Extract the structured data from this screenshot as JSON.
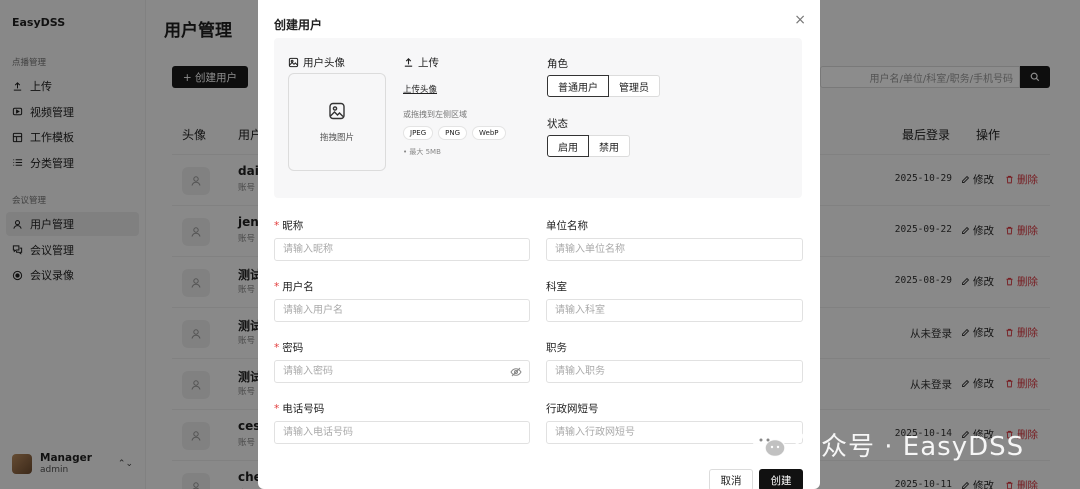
{
  "sidebar": {
    "brand": "EasyDSS",
    "groups": [
      {
        "title": "点播管理",
        "items": [
          {
            "label": "上传",
            "icon": "upload-icon"
          },
          {
            "label": "视频管理",
            "icon": "video-icon"
          },
          {
            "label": "工作模板",
            "icon": "template-icon"
          },
          {
            "label": "分类管理",
            "icon": "list-icon"
          }
        ]
      },
      {
        "title": "会议管理",
        "items": [
          {
            "label": "用户管理",
            "icon": "user-icon",
            "active": true
          },
          {
            "label": "会议管理",
            "icon": "meeting-icon"
          },
          {
            "label": "会议录像",
            "icon": "record-icon"
          }
        ]
      }
    ],
    "user": {
      "name": "Manager",
      "account": "admin"
    }
  },
  "page": {
    "title": "用户管理",
    "create_label": "+ 创建用户",
    "search_placeholder": "用户名/单位/科室/职务/手机号码",
    "columns": {
      "avatar": "头像",
      "user": "用户",
      "last_login": "最后登录",
      "ops": "操作"
    },
    "rows": [
      {
        "name": "dai",
        "account": "账号",
        "last_login": "2025-10-29"
      },
      {
        "name": "jen",
        "account": "账号",
        "last_login": "2025-09-22"
      },
      {
        "name": "测试",
        "account": "账号",
        "last_login": "2025-08-29"
      },
      {
        "name": "测试",
        "account": "账号",
        "last_login": "从未登录"
      },
      {
        "name": "测试",
        "account": "账号",
        "last_login": "从未登录"
      },
      {
        "name": "ces",
        "account": "账号",
        "last_login": "2025-10-14"
      },
      {
        "name": "che",
        "account": "账号",
        "last_login": "2025-10-11"
      }
    ],
    "edit_label": "修改",
    "delete_label": "删除"
  },
  "modal": {
    "title": "创建用户",
    "close": "×",
    "avatar_label": "用户头像",
    "drop_text": "拖拽图片",
    "upload_label": "上传",
    "upload_link": "上传头像",
    "upload_hint": "或拖拽到左侧区域",
    "formats": [
      "JPEG",
      "PNG",
      "WebP"
    ],
    "max_size": "• 最大 5MB",
    "role_label": "角色",
    "roles": [
      "普通用户",
      "管理员"
    ],
    "status_label": "状态",
    "statuses": [
      "启用",
      "禁用"
    ],
    "fields": {
      "nickname": {
        "label": "昵称",
        "placeholder": "请输入昵称",
        "required": true
      },
      "username": {
        "label": "用户名",
        "placeholder": "请输入用户名",
        "required": true
      },
      "password": {
        "label": "密码",
        "placeholder": "请输入密码",
        "required": true
      },
      "phone": {
        "label": "电话号码",
        "placeholder": "请输入电话号码",
        "required": true
      },
      "org": {
        "label": "单位名称",
        "placeholder": "请输入单位名称"
      },
      "dept": {
        "label": "科室",
        "placeholder": "请输入科室"
      },
      "position": {
        "label": "职务",
        "placeholder": "请输入职务"
      },
      "short_no": {
        "label": "行政网短号",
        "placeholder": "请输入行政网短号"
      }
    },
    "cancel_label": "取消",
    "submit_label": "创建"
  },
  "watermark": "公众号 · EasyDSS"
}
